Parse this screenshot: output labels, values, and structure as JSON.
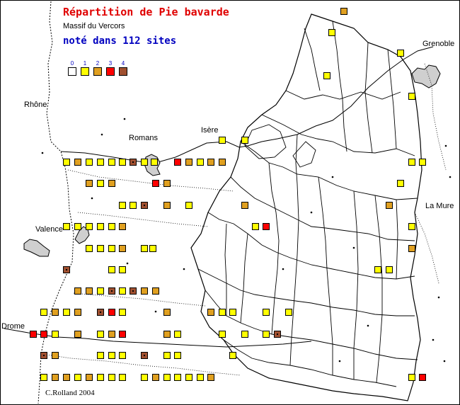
{
  "title": "Répartition de Pie bavarde",
  "subtitle": "Massif du Vercors",
  "site_count_text": "noté dans 112 sites",
  "credit": "C.Rolland 2004",
  "colors": {
    "0": "#ffffff",
    "1": "#ffff00",
    "2": "#e0a020",
    "3": "#ff0000",
    "4": "#a05030"
  },
  "legend": [
    {
      "label": "0",
      "level": 0
    },
    {
      "label": "1",
      "level": 1
    },
    {
      "label": "2",
      "level": 2
    },
    {
      "label": "3",
      "level": 3
    },
    {
      "label": "4",
      "level": 4
    }
  ],
  "places": {
    "rhone": "Rhône",
    "romans": "Romans",
    "isere": "Isère",
    "grenoble": "Grenoble",
    "valence": "Valence",
    "la_mure": "La Mure",
    "drome": "Drome"
  }
}
